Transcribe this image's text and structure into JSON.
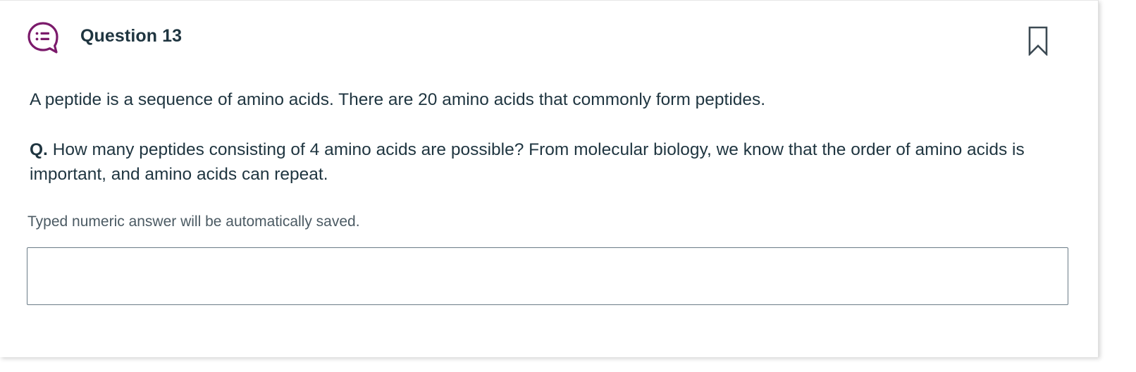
{
  "header": {
    "icon": "question-list-bubble-icon",
    "title": "Question 13",
    "bookmark_icon": "bookmark-outline-icon"
  },
  "body": {
    "intro": "A peptide is a sequence of amino acids. There are 20 amino acids that commonly form peptides.",
    "question_prefix": "Q.",
    "question_text": "How many peptides consisting of 4 amino acids are possible? From molecular biology, we know that the order of amino acids is important, and amino acids can repeat."
  },
  "answer": {
    "hint": "Typed numeric answer will be automatically saved.",
    "value": "",
    "placeholder": ""
  },
  "colors": {
    "accent": "#7b1a6b",
    "text": "#1f3540",
    "muted_text": "#4b5a63",
    "input_border": "#6b7c87",
    "bookmark": "#3c4a53"
  }
}
